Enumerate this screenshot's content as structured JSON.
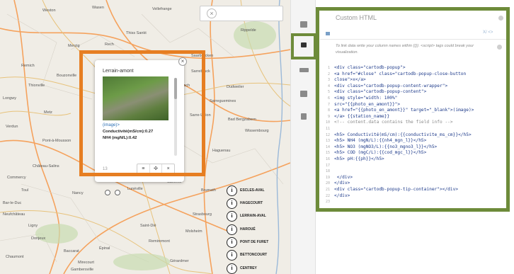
{
  "map": {
    "towns": [
      {
        "name": "Weston"
      },
      {
        "name": "Wasen"
      },
      {
        "name": "Vellefrange"
      },
      {
        "name": "Rippelde"
      },
      {
        "name": "Thiss Sankt"
      },
      {
        "name": "Rech"
      },
      {
        "name": "Merzig"
      },
      {
        "name": "Saarbrücken"
      },
      {
        "name": "Remich"
      },
      {
        "name": "Sarrebruck"
      },
      {
        "name": "Forbach"
      },
      {
        "name": "Thionville"
      },
      {
        "name": "Bouzonville"
      },
      {
        "name": "Dudweiler"
      },
      {
        "name": "Sarreguemines"
      },
      {
        "name": "Longwy"
      },
      {
        "name": "Metz"
      },
      {
        "name": "Sarre-Union"
      },
      {
        "name": "Verdun"
      },
      {
        "name": "Pont-à-Mousson"
      },
      {
        "name": "Bad Bergzabern"
      },
      {
        "name": "Wissembourg"
      },
      {
        "name": "Haguenau"
      },
      {
        "name": "Saverne"
      },
      {
        "name": "Château-Salins"
      },
      {
        "name": "Lunéville"
      },
      {
        "name": "Commercy"
      },
      {
        "name": "Toul"
      },
      {
        "name": "Nancy"
      },
      {
        "name": "Brumath"
      },
      {
        "name": "Strasbourg"
      },
      {
        "name": "Saint-Dié"
      },
      {
        "name": "Épinal"
      },
      {
        "name": "Remiremont"
      },
      {
        "name": "Neufchâteau"
      },
      {
        "name": "Bar-le-Duc"
      },
      {
        "name": "Baccarat"
      },
      {
        "name": "Ligny"
      },
      {
        "name": "Mirecourt"
      },
      {
        "name": "Gérardmer"
      },
      {
        "name": "Chaumont"
      },
      {
        "name": "Molsheim"
      },
      {
        "name": "Gambersville"
      },
      {
        "name": "Donjeux"
      }
    ],
    "popup": {
      "title": "Lerrain-amont",
      "image_link": "(image)>",
      "line1": "Conductivité(mS/cm):0.27",
      "line2": "NH4 (mgN/L):0.42",
      "count": "13",
      "close": "×",
      "tools": [
        "≡",
        "✣",
        "×"
      ]
    },
    "locations": [
      "ESCLES-AVAL",
      "HAGECOURT",
      "LERRAIN-AVAL",
      "HAROUÉ",
      "PONT DE FURET",
      "BETTONCOURT",
      "CENTREY"
    ],
    "location_icon": "i",
    "search_close": "×",
    "colors": {
      "land": "#f0ede6",
      "road": "#f5a25d",
      "highlight_orange": "#e67e22"
    }
  },
  "toolbar": {
    "tools": [
      "wizard-icon",
      "infowindow-icon",
      "legend-icon",
      "layers-icon",
      "filters-icon"
    ]
  },
  "panel": {
    "title": "Custom HTML",
    "tab_right": "X/ <>",
    "info_text": "To link data write your column names within {{}}. <script> tags could break your visualization.",
    "code_lines": [
      "<div class=\"cartodb-popup\">",
      "<a href=\"#close\" class=\"cartodb-popup-close-button",
      "close\">x</a>",
      "<div class=\"cartodb-popup-content-wrapper\">",
      "<div class=\"cartodb-popup-content\">",
      "<img style=\"width: 100%\"",
      "src=\"{{photo_en_amont}}\">",
      "<a href=\"{{photo_en_amont}}\" target=\"_blank\">(image)>",
      "</a> {{station_name}}",
      "<!-- content.data contains the field info -->",
      "",
      "<h5> Conductivité(mS/cm):{{conductivite_ms_cm}}</h5>",
      "<h5> NH4 (mgN/L):{{nh4_mgn_l}}</h5>",
      "<h5> NO3 (mgNO3/L):{{no3_mgno3_l}}</h5>",
      "<h5> COD (mgC/L):{{cod_mgc_l}}</h5>",
      "<h5> pH:{{ph}}</h5>",
      "",
      "",
      " </div>",
      "</div>",
      "<div class=\"cartodb-popup-tip-container\"></div>",
      "</div>",
      ""
    ],
    "line_numbers": [
      "1",
      "2",
      "3",
      "4",
      "5",
      "6",
      "7",
      "8",
      "9",
      "10",
      "11",
      "12",
      "13",
      "14",
      "15",
      "16",
      "17",
      "18",
      "19",
      "20",
      "21",
      "22",
      "23"
    ],
    "colors": {
      "code": "#1d3a8a",
      "highlight_green": "#6d8b3a"
    }
  }
}
